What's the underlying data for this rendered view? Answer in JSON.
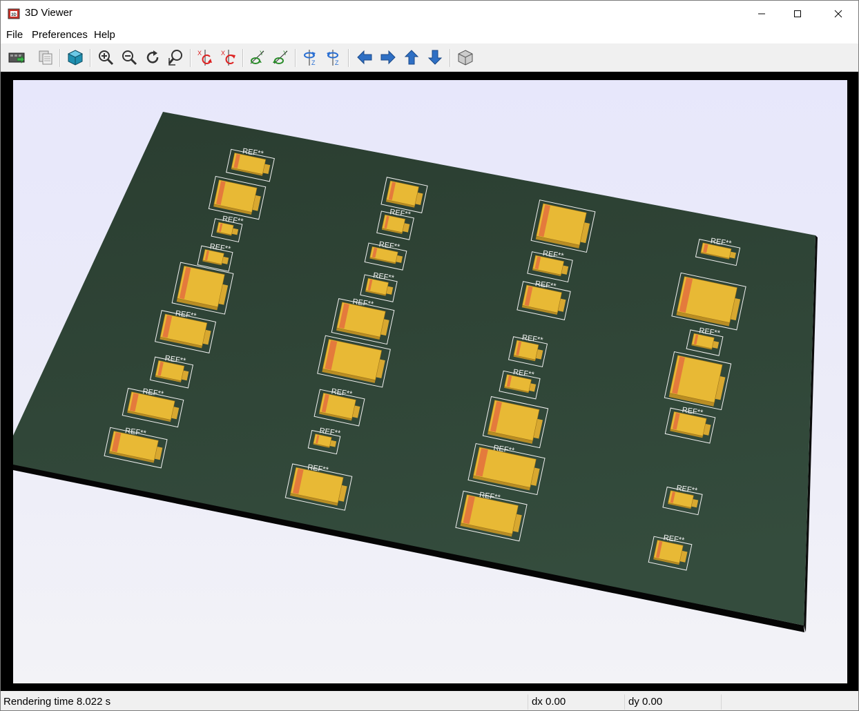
{
  "window": {
    "title": "3D Viewer"
  },
  "menu": {
    "file": "File",
    "preferences": "Preferences",
    "help": "Help"
  },
  "toolbar": {
    "buttons": [
      "reload-board",
      "copy-image",
      "render-raytrace",
      "zoom-in",
      "zoom-out",
      "redraw",
      "zoom-fit",
      "rotate-x-cw",
      "rotate-x-ccw",
      "rotate-y-cw",
      "rotate-y-ccw",
      "rotate-z-cw",
      "rotate-z-ccw",
      "pan-left",
      "pan-right",
      "pan-up",
      "pan-down",
      "iso-view"
    ]
  },
  "viewport": {
    "ref_label": "REF**",
    "board_color": "#2d4234",
    "component_color": "#e8b935",
    "band_color": "#e47a3c"
  },
  "status": {
    "rendering": "Rendering time 8.022 s",
    "dx": "dx 0.00",
    "dy": "dy 0.00"
  }
}
